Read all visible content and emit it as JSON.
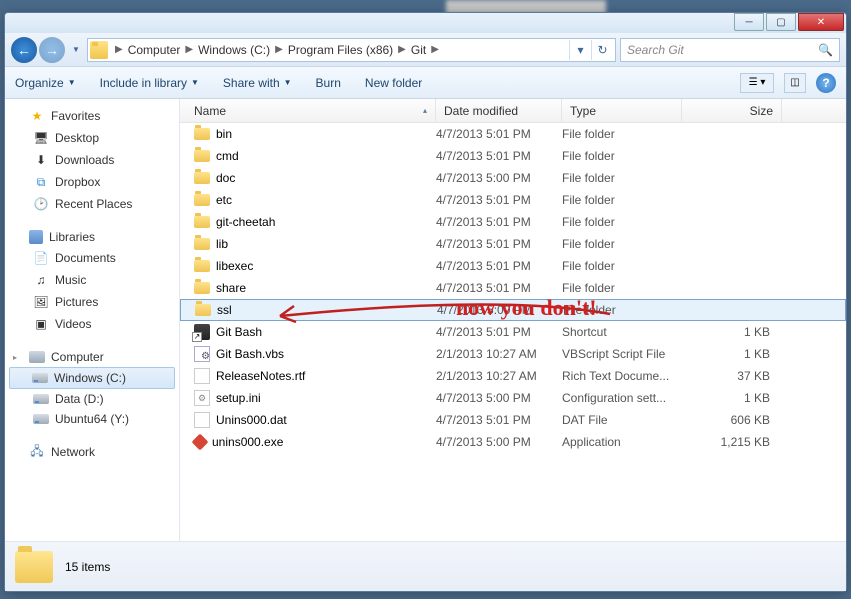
{
  "breadcrumb": [
    "Computer",
    "Windows (C:)",
    "Program Files (x86)",
    "Git"
  ],
  "search": {
    "placeholder": "Search Git"
  },
  "toolbar": {
    "organize": "Organize",
    "include": "Include in library",
    "share": "Share with",
    "burn": "Burn",
    "newfolder": "New folder"
  },
  "sidebar": {
    "favorites": {
      "label": "Favorites",
      "items": [
        "Desktop",
        "Downloads",
        "Dropbox",
        "Recent Places"
      ]
    },
    "libraries": {
      "label": "Libraries",
      "items": [
        "Documents",
        "Music",
        "Pictures",
        "Videos"
      ]
    },
    "computer": {
      "label": "Computer",
      "items": [
        "Windows (C:)",
        "Data (D:)",
        "Ubuntu64 (Y:)"
      ]
    },
    "network": {
      "label": "Network"
    }
  },
  "columns": {
    "name": "Name",
    "date": "Date modified",
    "type": "Type",
    "size": "Size"
  },
  "files": [
    {
      "name": "bin",
      "date": "4/7/2013 5:01 PM",
      "type": "File folder",
      "size": "",
      "icon": "folder"
    },
    {
      "name": "cmd",
      "date": "4/7/2013 5:01 PM",
      "type": "File folder",
      "size": "",
      "icon": "folder"
    },
    {
      "name": "doc",
      "date": "4/7/2013 5:00 PM",
      "type": "File folder",
      "size": "",
      "icon": "folder"
    },
    {
      "name": "etc",
      "date": "4/7/2013 5:01 PM",
      "type": "File folder",
      "size": "",
      "icon": "folder"
    },
    {
      "name": "git-cheetah",
      "date": "4/7/2013 5:01 PM",
      "type": "File folder",
      "size": "",
      "icon": "folder"
    },
    {
      "name": "lib",
      "date": "4/7/2013 5:01 PM",
      "type": "File folder",
      "size": "",
      "icon": "folder"
    },
    {
      "name": "libexec",
      "date": "4/7/2013 5:01 PM",
      "type": "File folder",
      "size": "",
      "icon": "folder"
    },
    {
      "name": "share",
      "date": "4/7/2013 5:01 PM",
      "type": "File folder",
      "size": "",
      "icon": "folder"
    },
    {
      "name": "ssl",
      "date": "4/7/2013 5:00 PM",
      "type": "File folder",
      "size": "",
      "icon": "folder",
      "selected": true
    },
    {
      "name": "Git Bash",
      "date": "4/7/2013 5:01 PM",
      "type": "Shortcut",
      "size": "1 KB",
      "icon": "shortcut"
    },
    {
      "name": "Git Bash.vbs",
      "date": "2/1/2013 10:27 AM",
      "type": "VBScript Script File",
      "size": "1 KB",
      "icon": "vbs"
    },
    {
      "name": "ReleaseNotes.rtf",
      "date": "2/1/2013 10:27 AM",
      "type": "Rich Text Docume...",
      "size": "37 KB",
      "icon": "rtf"
    },
    {
      "name": "setup.ini",
      "date": "4/7/2013 5:00 PM",
      "type": "Configuration sett...",
      "size": "1 KB",
      "icon": "ini"
    },
    {
      "name": "Unins000.dat",
      "date": "4/7/2013 5:01 PM",
      "type": "DAT File",
      "size": "606 KB",
      "icon": "dat"
    },
    {
      "name": "unins000.exe",
      "date": "4/7/2013 5:00 PM",
      "type": "Application",
      "size": "1,215 KB",
      "icon": "exe"
    }
  ],
  "status": {
    "count": "15 items"
  },
  "annotation": {
    "text": "now you don't!"
  }
}
